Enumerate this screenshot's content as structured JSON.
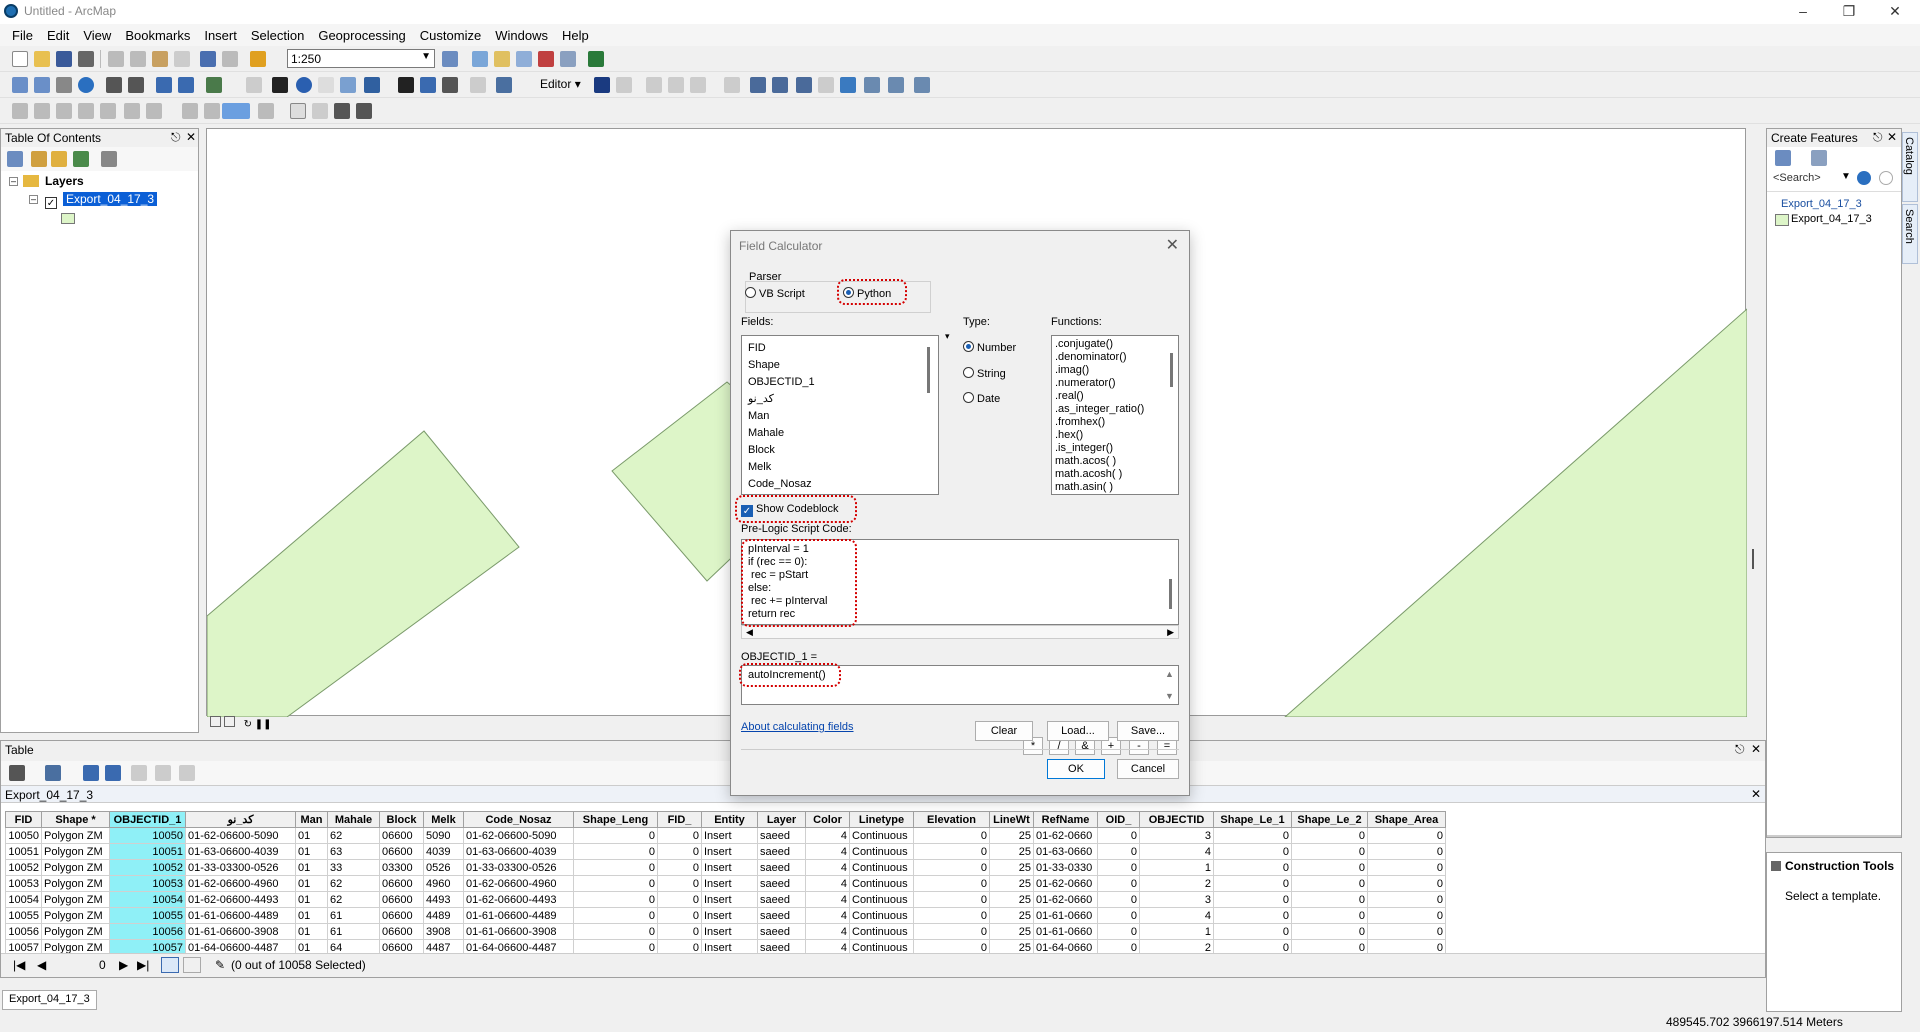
{
  "window": {
    "title": "Untitled - ArcMap"
  },
  "menu": [
    "File",
    "Edit",
    "View",
    "Bookmarks",
    "Insert",
    "Selection",
    "Geoprocessing",
    "Customize",
    "Windows",
    "Help"
  ],
  "toolbar": {
    "scale": "1:250",
    "editor_label": "Editor"
  },
  "toc": {
    "title": "Table Of Contents",
    "root": "Layers",
    "layer": "Export_04_17_3"
  },
  "create_features": {
    "title": "Create Features",
    "search_placeholder": "<Search>",
    "group": "Export_04_17_3",
    "item": "Export_04_17_3",
    "side_tabs": [
      "Catalog",
      "Search"
    ]
  },
  "construction_tools": {
    "title": "Construction Tools",
    "hint": "Select a template."
  },
  "dialog": {
    "title": "Field Calculator",
    "parser_label": "Parser",
    "parser_vb": "VB Script",
    "parser_python": "Python",
    "fields_label": "Fields:",
    "fields": [
      "FID",
      "Shape",
      "OBJECTID_1",
      "کد_نو",
      "Man",
      "Mahale",
      "Block",
      "Melk",
      "Code_Nosaz"
    ],
    "type_label": "Type:",
    "types": [
      "Number",
      "String",
      "Date"
    ],
    "functions_label": "Functions:",
    "functions": [
      ".conjugate()",
      ".denominator()",
      ".imag()",
      ".numerator()",
      ".real()",
      ".as_integer_ratio()",
      ".fromhex()",
      ".hex()",
      ".is_integer()",
      "math.acos( )",
      "math.acosh( )",
      "math.asin( )"
    ],
    "show_codeblock": "Show Codeblock",
    "operators": [
      "*",
      "/",
      "&",
      "+",
      "-",
      "="
    ],
    "codeblock_label": "Pre-Logic Script Code:",
    "codeblock_lines": [
      "pInterval = 1",
      "if (rec == 0):",
      " rec = pStart",
      "else:",
      " rec += pInterval",
      "return rec"
    ],
    "expression_label": "OBJECTID_1 =",
    "expression": "autoIncrement()",
    "about_link": "About calculating fields",
    "buttons": {
      "clear": "Clear",
      "load": "Load...",
      "save": "Save...",
      "ok": "OK",
      "cancel": "Cancel"
    }
  },
  "table": {
    "window_title": "Table",
    "name": "Export_04_17_3",
    "columns": [
      "FID",
      "Shape *",
      "OBJECTID_1",
      "کد_نو",
      "Man",
      "Mahale",
      "Block",
      "Melk",
      "Code_Nosaz",
      "Shape_Leng",
      "FID_",
      "Entity",
      "Layer",
      "Color",
      "Linetype",
      "Elevation",
      "LineWt",
      "RefName",
      "OID_",
      "OBJECTID",
      "Shape_Le_1",
      "Shape_Le_2",
      "Shape_Area"
    ],
    "rows": [
      [
        "10050",
        "Polygon ZM",
        "10050",
        "01-62-06600-5090",
        "01",
        "62",
        "06600",
        "5090",
        "01-62-06600-5090",
        "0",
        "0",
        "Insert",
        "saeed",
        "4",
        "Continuous",
        "0",
        "25",
        "01-62-0660",
        "0",
        "3",
        "0",
        "0",
        "0"
      ],
      [
        "10051",
        "Polygon ZM",
        "10051",
        "01-63-06600-4039",
        "01",
        "63",
        "06600",
        "4039",
        "01-63-06600-4039",
        "0",
        "0",
        "Insert",
        "saeed",
        "4",
        "Continuous",
        "0",
        "25",
        "01-63-0660",
        "0",
        "4",
        "0",
        "0",
        "0"
      ],
      [
        "10052",
        "Polygon ZM",
        "10052",
        "01-33-03300-0526",
        "01",
        "33",
        "03300",
        "0526",
        "01-33-03300-0526",
        "0",
        "0",
        "Insert",
        "saeed",
        "4",
        "Continuous",
        "0",
        "25",
        "01-33-0330",
        "0",
        "1",
        "0",
        "0",
        "0"
      ],
      [
        "10053",
        "Polygon ZM",
        "10053",
        "01-62-06600-4960",
        "01",
        "62",
        "06600",
        "4960",
        "01-62-06600-4960",
        "0",
        "0",
        "Insert",
        "saeed",
        "4",
        "Continuous",
        "0",
        "25",
        "01-62-0660",
        "0",
        "2",
        "0",
        "0",
        "0"
      ],
      [
        "10054",
        "Polygon ZM",
        "10054",
        "01-62-06600-4493",
        "01",
        "62",
        "06600",
        "4493",
        "01-62-06600-4493",
        "0",
        "0",
        "Insert",
        "saeed",
        "4",
        "Continuous",
        "0",
        "25",
        "01-62-0660",
        "0",
        "3",
        "0",
        "0",
        "0"
      ],
      [
        "10055",
        "Polygon ZM",
        "10055",
        "01-61-06600-4489",
        "01",
        "61",
        "06600",
        "4489",
        "01-61-06600-4489",
        "0",
        "0",
        "Insert",
        "saeed",
        "4",
        "Continuous",
        "0",
        "25",
        "01-61-0660",
        "0",
        "4",
        "0",
        "0",
        "0"
      ],
      [
        "10056",
        "Polygon ZM",
        "10056",
        "01-61-06600-3908",
        "01",
        "61",
        "06600",
        "3908",
        "01-61-06600-3908",
        "0",
        "0",
        "Insert",
        "saeed",
        "4",
        "Continuous",
        "0",
        "25",
        "01-61-0660",
        "0",
        "1",
        "0",
        "0",
        "0"
      ],
      [
        "10057",
        "Polygon ZM",
        "10057",
        "01-64-06600-4487",
        "01",
        "64",
        "06600",
        "4487",
        "01-64-06600-4487",
        "0",
        "0",
        "Insert",
        "saeed",
        "4",
        "Continuous",
        "0",
        "25",
        "01-64-0660",
        "0",
        "2",
        "0",
        "0",
        "0"
      ]
    ],
    "record_index": "0",
    "selection_status": "(0 out of 10058 Selected)",
    "tab": "Export_04_17_3"
  },
  "status": {
    "coordinates": "489545.702  3966197.514 Meters"
  },
  "colors": {
    "polygon_fill": "#ddf5c8",
    "selected_column": "#8ff0f7",
    "highlight": "#d40000"
  }
}
